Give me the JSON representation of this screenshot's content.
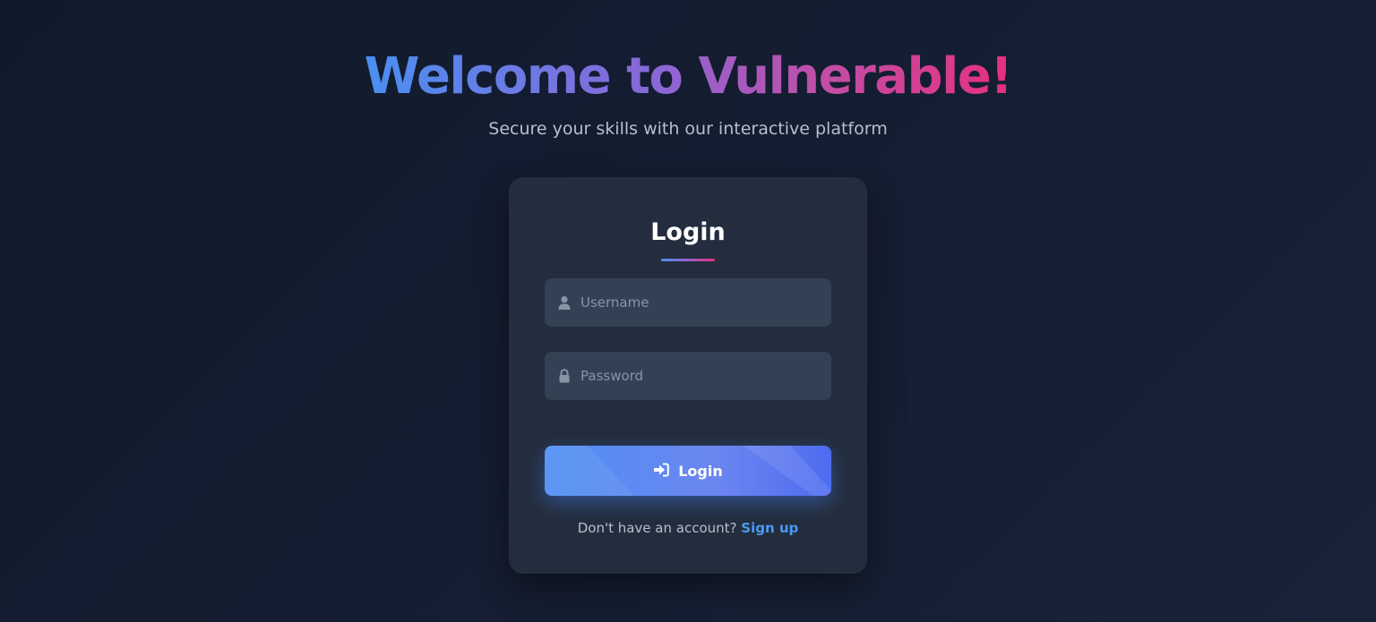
{
  "hero": {
    "title": "Welcome to Vulnerable!",
    "subtitle": "Secure your skills with our interactive platform"
  },
  "login_card": {
    "title": "Login",
    "username": {
      "placeholder": "Username",
      "value": "",
      "icon": "user-icon"
    },
    "password": {
      "placeholder": "Password",
      "value": "",
      "icon": "lock-icon"
    },
    "submit": {
      "label": "Login",
      "icon": "sign-in-icon"
    },
    "signup_prompt": "Don't have an account?",
    "signup_link": "Sign up"
  },
  "colors": {
    "background": "#131c2f",
    "card": "#232d3d",
    "input": "#334155",
    "accent_blue": "#4a8ff2",
    "accent_pink": "#e6307e",
    "link": "#4a9af5"
  }
}
